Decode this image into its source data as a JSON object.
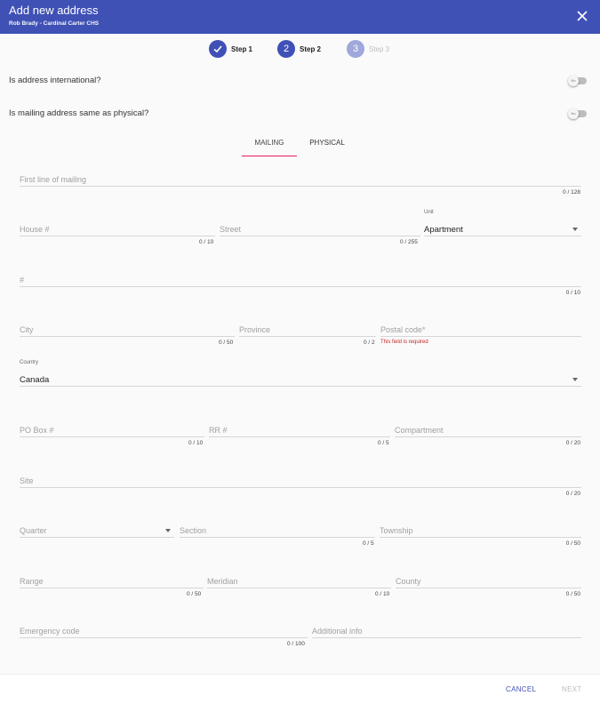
{
  "dialog": {
    "title": "Add new address",
    "subtitle": "Rob Brady - Cardinal Carter CHS"
  },
  "steps": [
    {
      "number": "✓",
      "label": "Step 1"
    },
    {
      "number": "2",
      "label": "Step 2"
    },
    {
      "number": "3",
      "label": "Step 3"
    }
  ],
  "questions": {
    "international": {
      "label": "Is address international?",
      "toggle": "No"
    },
    "same_as_physical": {
      "label": "Is mailing address same as physical?",
      "toggle": "No"
    }
  },
  "tabs": [
    {
      "label": "MAILING"
    },
    {
      "label": "PHYSICAL"
    }
  ],
  "fields": {
    "first_line": {
      "placeholder": "First line of mailing",
      "counter": "0 / 128"
    },
    "house": {
      "placeholder": "House #",
      "counter": "0 / 10"
    },
    "street": {
      "placeholder": "Street",
      "counter": "0 / 255"
    },
    "unit": {
      "label": "Unit",
      "value": "Apartment"
    },
    "unit_number": {
      "placeholder": "#",
      "counter": "0 / 10"
    },
    "city": {
      "placeholder": "City",
      "counter": "0 / 50"
    },
    "province": {
      "placeholder": "Province",
      "counter": "0 / 2"
    },
    "postal_code": {
      "placeholder": "Postal code",
      "required": "*",
      "error": "This field is required"
    },
    "country": {
      "label": "Country",
      "value": "Canada"
    },
    "po_box": {
      "placeholder": "PO Box #",
      "counter": "0 / 10"
    },
    "rr": {
      "placeholder": "RR #",
      "counter": "0 / 5"
    },
    "compartment": {
      "placeholder": "Compartment",
      "counter": "0 / 20"
    },
    "site": {
      "placeholder": "Site",
      "counter": "0 / 20"
    },
    "quarter": {
      "placeholder": "Quarter"
    },
    "section": {
      "placeholder": "Section",
      "counter": "0 / 5"
    },
    "township": {
      "placeholder": "Township",
      "counter": "0 / 50"
    },
    "range": {
      "placeholder": "Range",
      "counter": "0 / 50"
    },
    "meridian": {
      "placeholder": "Meridian",
      "counter": "0 / 10"
    },
    "county": {
      "placeholder": "County",
      "counter": "0 / 50"
    },
    "emergency": {
      "placeholder": "Emergency code",
      "counter": "0 / 100"
    },
    "additional": {
      "placeholder": "Additional info"
    }
  },
  "footer": {
    "cancel": "CANCEL",
    "next": "NEXT"
  },
  "colors": {
    "primary": "#3f51b5",
    "accent": "#e91e63",
    "error": "#c62828",
    "disabled": "#9fa8da"
  },
  "icons": {
    "close": "close-icon",
    "check": "check-icon",
    "dropdown": "chevron-down-icon"
  }
}
